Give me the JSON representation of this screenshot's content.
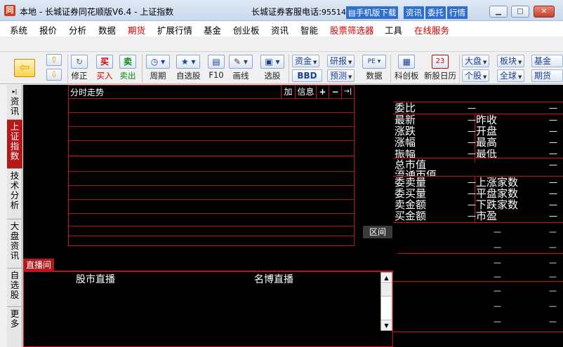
{
  "window": {
    "title": "本地 - 长城证券同花顺版V6.4 - 上证指数",
    "hotline_label": "长城证券客服电话:",
    "hotline_number": "95514",
    "links": [
      "手机版下载",
      "资讯",
      "委托",
      "行情"
    ],
    "app_icon": "同"
  },
  "menus": [
    {
      "label": "系统",
      "color": "#000000"
    },
    {
      "label": "报价",
      "color": "#000000"
    },
    {
      "label": "分析",
      "color": "#000000"
    },
    {
      "label": "数据",
      "color": "#000000"
    },
    {
      "label": "期货",
      "color": "#d20000"
    },
    {
      "label": "扩展行情",
      "color": "#000000"
    },
    {
      "label": "基金",
      "color": "#000000"
    },
    {
      "label": "创业板",
      "color": "#000000"
    },
    {
      "label": "资讯",
      "color": "#000000"
    },
    {
      "label": "智能",
      "color": "#000000"
    },
    {
      "label": "股票筛选器",
      "color": "#d20000"
    },
    {
      "label": "工具",
      "color": "#000000"
    },
    {
      "label": "在线服务",
      "color": "#d20000"
    }
  ],
  "toolbar": {
    "xiuzheng": "修正",
    "buy": "买入",
    "sell": "卖出",
    "buy_glyph": "买",
    "sell_glyph": "卖",
    "period": "周期",
    "zixuan": "自选股",
    "f10": "F10",
    "draw": "画线",
    "select_stock": "选股",
    "zijin": "资金",
    "bbd": "BBD",
    "yanbao": "研报",
    "yuce": "预测",
    "shuju": "数据",
    "kechuang": "科创板",
    "xingu": "新股日历",
    "calendar_day": "23",
    "dapan": "大盘",
    "gegu": "个股",
    "bankuai": "板块",
    "quanqiu": "全球",
    "jijin": "基金",
    "qihuo": "期货"
  },
  "leftnav": {
    "tabs": [
      "资讯",
      "上证指数",
      "技术分析",
      "大盘资讯",
      "自选股",
      "更多"
    ],
    "active": "上证指数"
  },
  "chart": {
    "title": "分时走势",
    "btn_add": "加",
    "btn_info": "信息",
    "btn_plus": "+",
    "btn_minus": "−",
    "btn_arrow": "→|",
    "qujian": "区间"
  },
  "live": {
    "tab": "直播间",
    "stock_live": "股市直播",
    "mingbo_live": "名博直播"
  },
  "quote": {
    "weibi": "委比",
    "rows_pair": [
      [
        "最新",
        "昨收"
      ],
      [
        "涨跌",
        "开盘"
      ],
      [
        "涨幅",
        "最高"
      ],
      [
        "振幅",
        "最低"
      ]
    ],
    "zong_shizhi": "总市值",
    "liutong_shizhi": "流通市值",
    "rows_pair2": [
      [
        "委卖量",
        "上涨家数"
      ],
      [
        "委买量",
        "平盘家数"
      ],
      [
        "卖金额",
        "下跌家数"
      ],
      [
        "买金额",
        "市盈"
      ]
    ],
    "dash": "—"
  }
}
